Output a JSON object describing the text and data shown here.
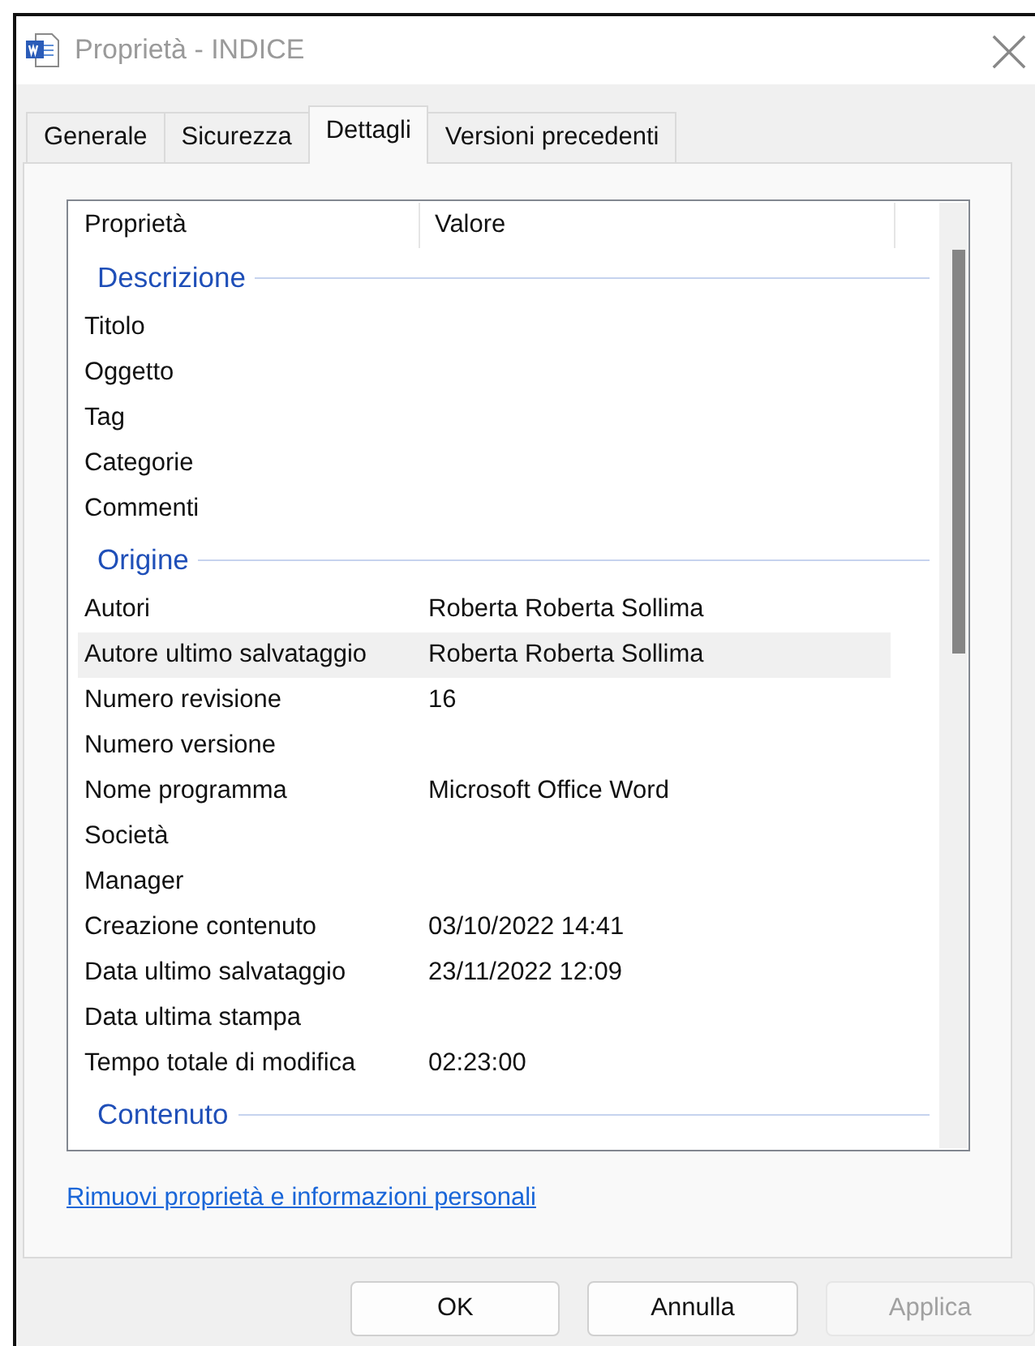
{
  "window": {
    "title": "Proprietà - INDICE"
  },
  "tabs": [
    {
      "label": "Generale",
      "selected": false
    },
    {
      "label": "Sicurezza",
      "selected": false
    },
    {
      "label": "Dettagli",
      "selected": true
    },
    {
      "label": "Versioni precedenti",
      "selected": false
    }
  ],
  "table": {
    "columns": [
      "Proprietà",
      "Valore"
    ],
    "groups": [
      {
        "title": "Descrizione",
        "rows": [
          {
            "name": "Titolo",
            "value": "",
            "selected": false
          },
          {
            "name": "Oggetto",
            "value": "",
            "selected": false
          },
          {
            "name": "Tag",
            "value": "",
            "selected": false
          },
          {
            "name": "Categorie",
            "value": "",
            "selected": false
          },
          {
            "name": "Commenti",
            "value": "",
            "selected": false
          }
        ]
      },
      {
        "title": "Origine",
        "rows": [
          {
            "name": "Autori",
            "value": "Roberta Roberta Sollima",
            "selected": false
          },
          {
            "name": "Autore ultimo salvataggio",
            "value": "Roberta Roberta Sollima",
            "selected": true
          },
          {
            "name": "Numero revisione",
            "value": "16",
            "selected": false
          },
          {
            "name": "Numero versione",
            "value": "",
            "selected": false
          },
          {
            "name": "Nome programma",
            "value": "Microsoft Office Word",
            "selected": false
          },
          {
            "name": "Società",
            "value": "",
            "selected": false
          },
          {
            "name": "Manager",
            "value": "",
            "selected": false
          },
          {
            "name": "Creazione contenuto",
            "value": "03/10/2022 14:41",
            "selected": false
          },
          {
            "name": "Data ultimo salvataggio",
            "value": "23/11/2022 12:09",
            "selected": false
          },
          {
            "name": "Data ultima stampa",
            "value": "",
            "selected": false
          },
          {
            "name": "Tempo totale di modifica",
            "value": "02:23:00",
            "selected": false
          }
        ]
      },
      {
        "title": "Contenuto"
      }
    ]
  },
  "link": "Rimuovi proprietà e informazioni personali",
  "buttons": [
    {
      "label": "OK",
      "disabled": false
    },
    {
      "label": "Annulla",
      "disabled": false
    },
    {
      "label": "Applica",
      "disabled": true
    }
  ]
}
